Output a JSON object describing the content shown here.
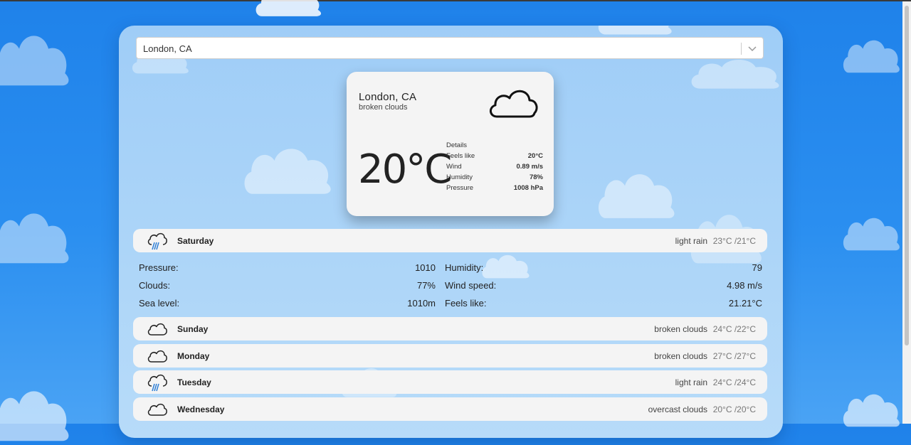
{
  "search": {
    "value": "London, CA"
  },
  "current": {
    "city": "London, CA",
    "description": "broken clouds",
    "icon": "cloud-icon",
    "temperature": "20°C",
    "details": {
      "heading": "Details",
      "rows": [
        {
          "label": "Feels like",
          "value": "20°C"
        },
        {
          "label": "Wind",
          "value": "0.89 m/s"
        },
        {
          "label": "Humidity",
          "value": "78%"
        },
        {
          "label": "Pressure",
          "value": "1008 hPa"
        }
      ]
    }
  },
  "forecast": [
    {
      "day": "Saturday",
      "description": "light rain",
      "temps": "23°C /21°C",
      "icon": "rain-cloud-icon"
    },
    {
      "day": "Sunday",
      "description": "broken clouds",
      "temps": "24°C /22°C",
      "icon": "cloud-icon"
    },
    {
      "day": "Monday",
      "description": "broken clouds",
      "temps": "27°C /27°C",
      "icon": "cloud-icon"
    },
    {
      "day": "Tuesday",
      "description": "light rain",
      "temps": "24°C /24°C",
      "icon": "rain-cloud-icon"
    },
    {
      "day": "Wednesday",
      "description": "overcast clouds",
      "temps": "20°C /20°C",
      "icon": "cloud-icon"
    }
  ],
  "expanded": {
    "rows": [
      {
        "label1": "Pressure:",
        "value1": "1010",
        "label2": "Humidity:",
        "value2": "79"
      },
      {
        "label1": "Clouds:",
        "value1": "77%",
        "label2": "Wind speed:",
        "value2": "4.98 m/s"
      },
      {
        "label1": "Sea level:",
        "value1": "1010m",
        "label2": "Feels like:",
        "value2": "21.21°C"
      }
    ]
  },
  "colors": {
    "sky": "#1f82ea",
    "card": "#f4f4f4",
    "rain": "#2e7fd6"
  }
}
